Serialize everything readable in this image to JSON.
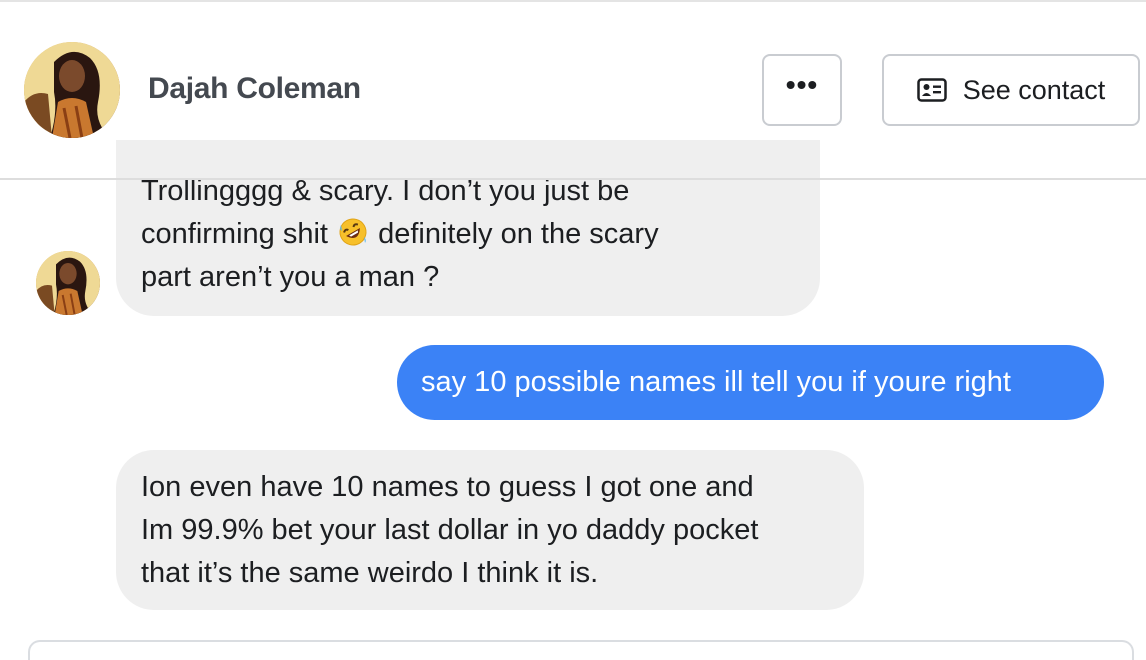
{
  "header": {
    "contact_name": "Dajah Coleman",
    "avatar_icon": "avatar-photo",
    "more_button_label": "•••",
    "see_contact_label": "See contact",
    "see_contact_icon": "contact-card-icon"
  },
  "conversation": {
    "messages": [
      {
        "direction": "incoming",
        "lines": [
          "Trollingggg & scary. I don’t you just be",
          "confirming shit",
          "definitely on the scary",
          "part aren’t you a man ?"
        ],
        "emoji": "rolling-on-floor-laughing-emoji"
      },
      {
        "direction": "outgoing",
        "text": "say 10 possible names ill tell you if youre right"
      },
      {
        "direction": "incoming",
        "lines": [
          "Ion even have 10 names to guess I got one and",
          "Im 99.9% bet your last dollar in yo daddy pocket",
          "that it’s the same weirdo I think it is."
        ]
      }
    ]
  },
  "colors": {
    "outgoing_bubble": "#3b82f6",
    "incoming_bubble": "#efefef",
    "name_text": "#444950"
  }
}
